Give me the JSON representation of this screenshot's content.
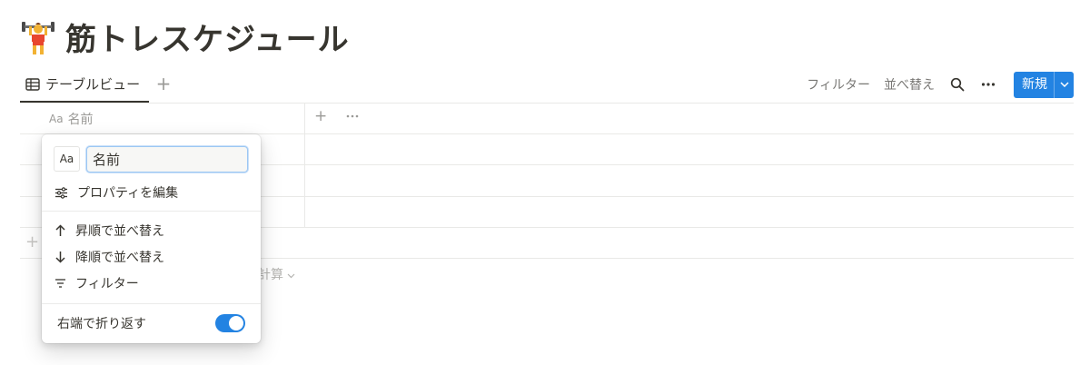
{
  "page": {
    "title": "筋トレスケジュール",
    "emoji_icon": "weight-lifter-icon"
  },
  "views": {
    "active_tab": "テーブルビュー",
    "add_view": "+"
  },
  "toolbar": {
    "filter": "フィルター",
    "sort": "並べ替え",
    "new_button": "新規"
  },
  "table": {
    "columns": [
      {
        "type_icon": "Aa",
        "name": "名前"
      }
    ],
    "add_column": "+",
    "add_row": "+",
    "calculate": "計算",
    "row_count": 3
  },
  "property_menu": {
    "type_label": "Aa",
    "name_value": "名前",
    "edit_property": "プロパティを編集",
    "sort_ascending": "昇順で並べ替え",
    "sort_descending": "降順で並べ替え",
    "filter": "フィルター",
    "wrap_text": "右端で折り返す",
    "wrap_enabled": true
  },
  "colors": {
    "accent": "#2383e2",
    "text": "#37352f",
    "muted": "#9b9a97",
    "divider": "#e9e9e7"
  }
}
